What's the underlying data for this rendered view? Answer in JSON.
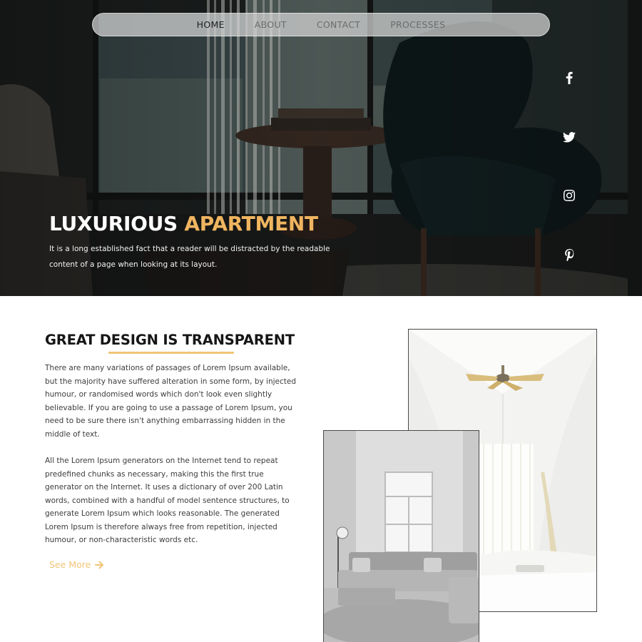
{
  "nav": {
    "items": [
      {
        "label": "HOME",
        "active": true
      },
      {
        "label": "ABOUT",
        "active": false
      },
      {
        "label": "CONTACT",
        "active": false
      },
      {
        "label": "PROCESSES",
        "active": false
      }
    ]
  },
  "social": [
    {
      "icon": "facebook-icon"
    },
    {
      "icon": "twitter-icon"
    },
    {
      "icon": "instagram-icon"
    },
    {
      "icon": "pinterest-icon"
    }
  ],
  "hero": {
    "title_white": "LUXURIOUS",
    "title_accent": "APARTMENT",
    "subtitle_line1": "It is a long established fact that a reader will be distracted by the readable",
    "subtitle_line2": "content of a page when looking at its layout."
  },
  "section": {
    "title": "GREAT DESIGN IS TRANSPARENT",
    "paragraph1": "There are many variations of passages of Lorem Ipsum available, but the majority have suffered alteration in some form, by injected humour, or randomised words which don't look even slightly believable. If you are going to use a passage of Lorem Ipsum, you need to be sure there isn't anything embarrassing hidden in the middle of text.",
    "paragraph2": "All the Lorem Ipsum generators on the Internet tend to repeat predefined chunks as necessary, making this the first true generator on the Internet. It uses a dictionary of over 200 Latin words, combined with a handful of model sentence structures, to generate Lorem Ipsum which looks reasonable. The generated Lorem Ipsum is therefore always free from repetition, injected humour, or non-characteristic words etc.",
    "see_more": "See More"
  },
  "colors": {
    "accent": "#f0b560",
    "underline": "#f0c577",
    "text": "#3c3c3c"
  }
}
